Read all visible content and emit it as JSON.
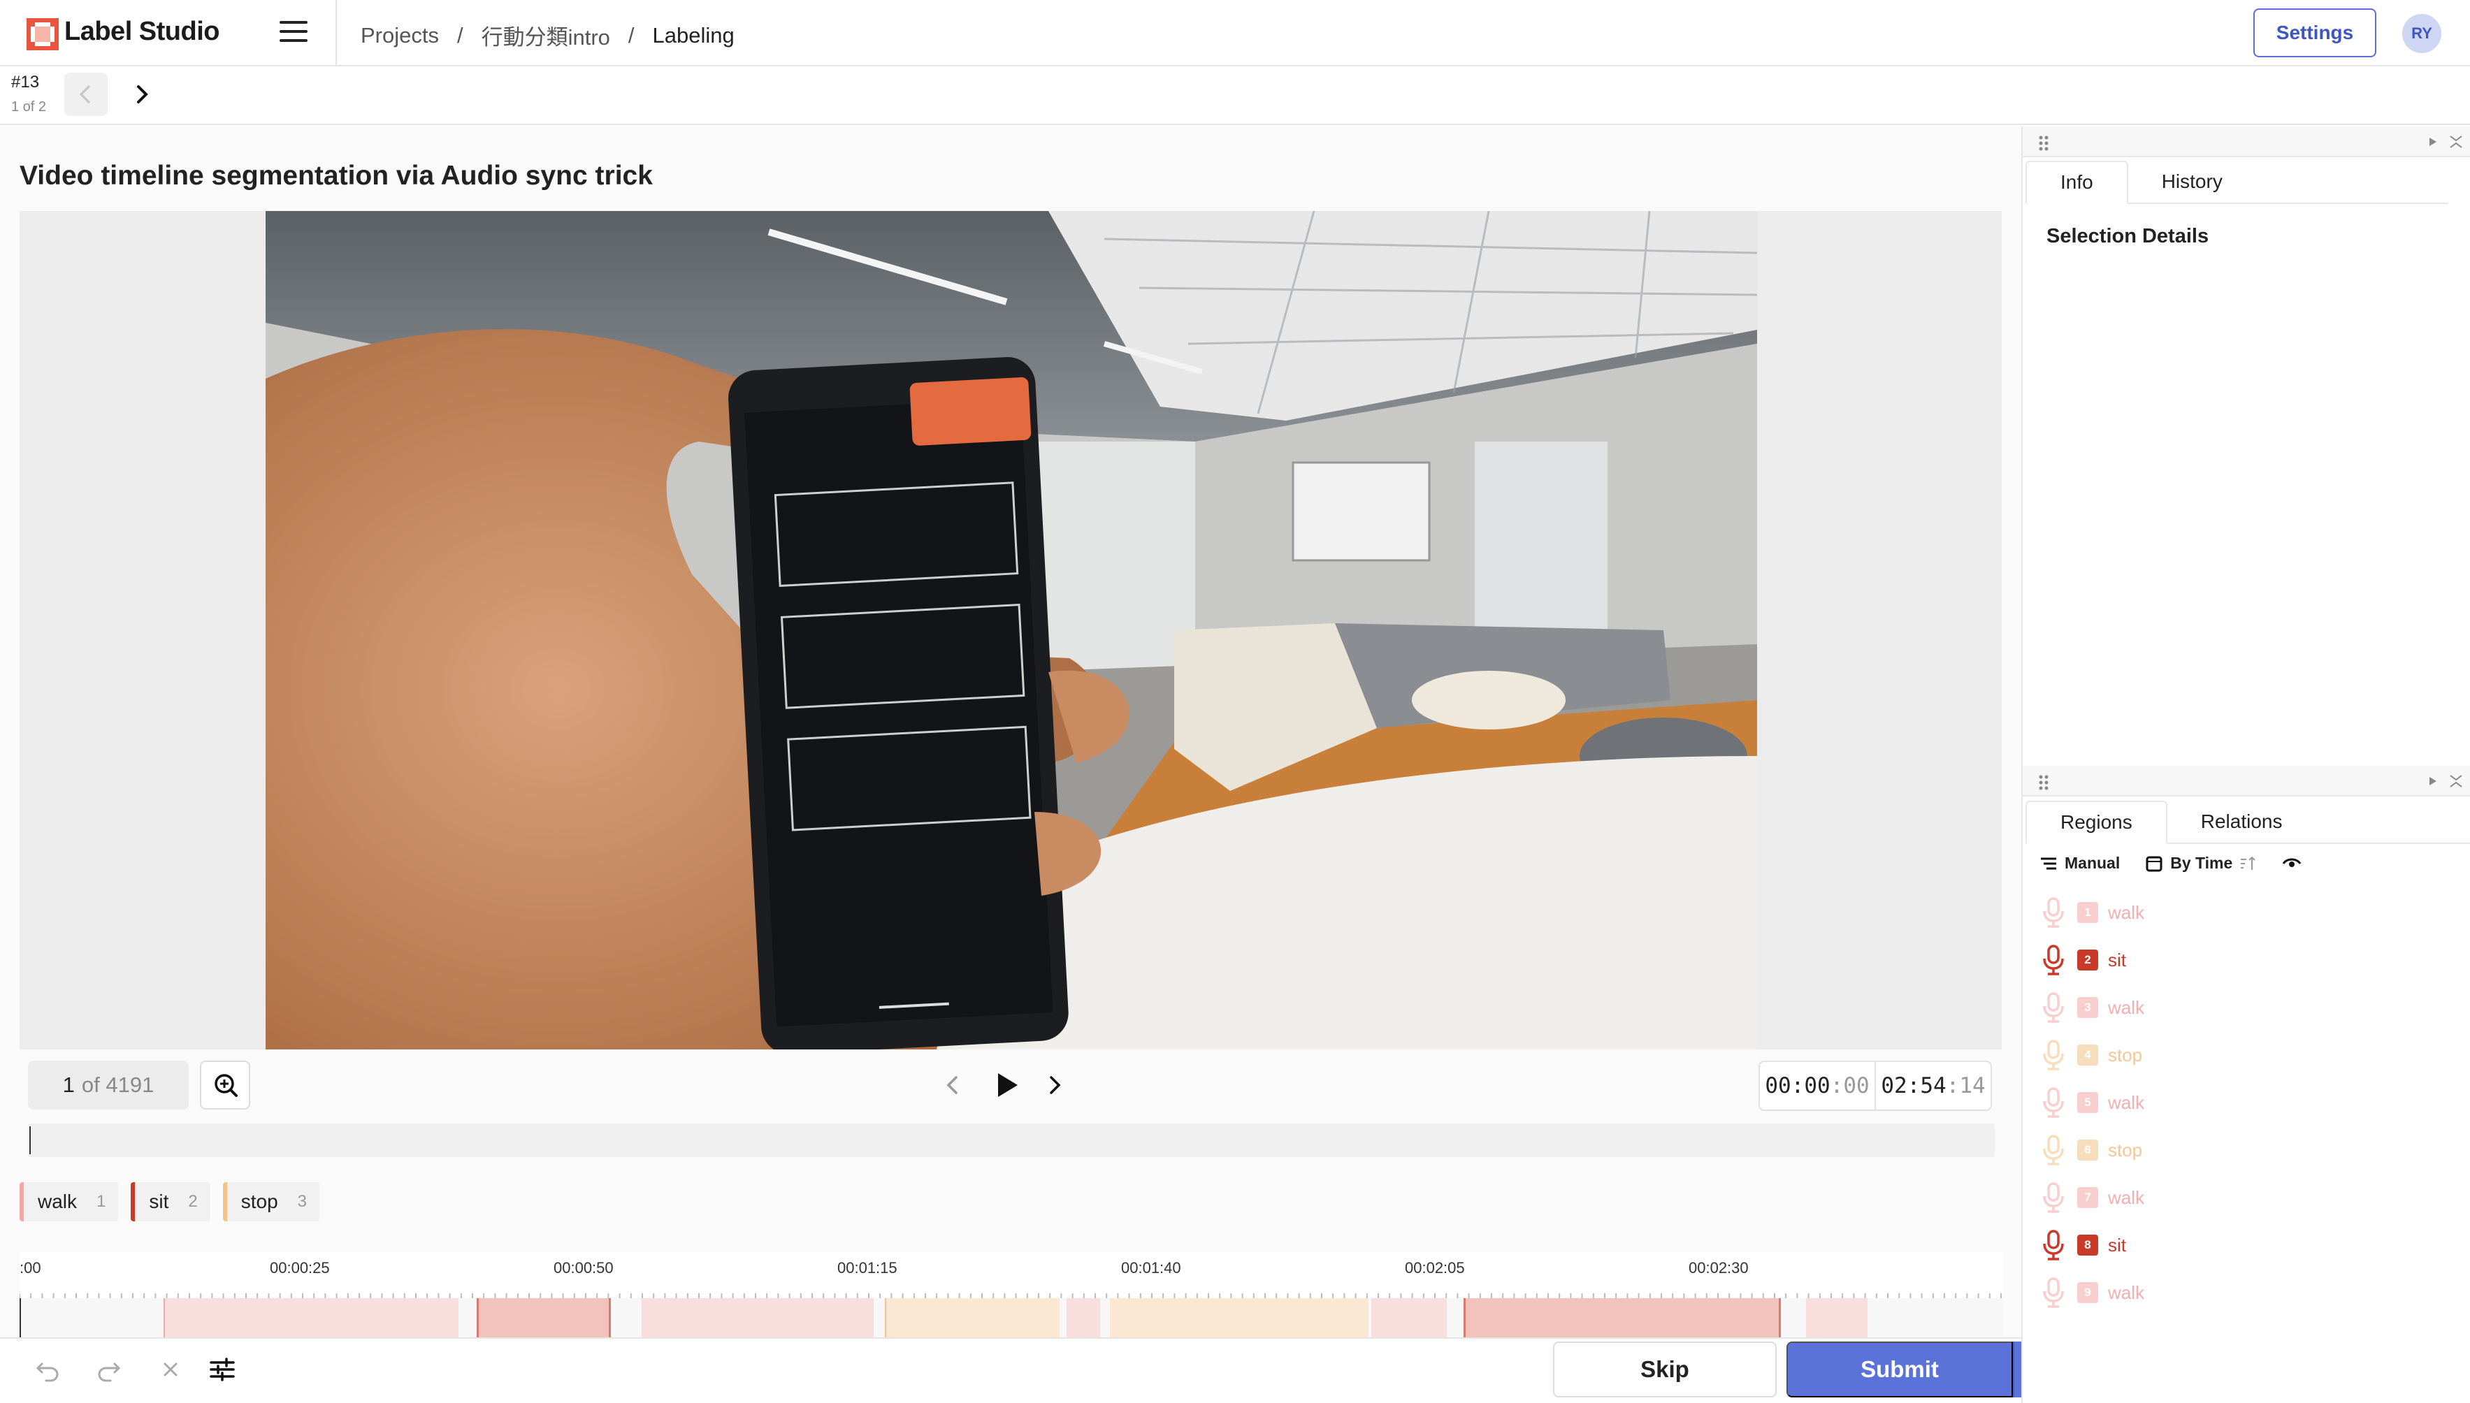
{
  "app": {
    "name": "Label Studio"
  },
  "breadcrumb": [
    "Projects",
    "/",
    "行動分類intro",
    "/",
    "Labeling"
  ],
  "header": {
    "settings_label": "Settings",
    "avatar_initials": "RY"
  },
  "task": {
    "id": "#13",
    "position": "1 of 2"
  },
  "main": {
    "title": "Video timeline segmentation via Audio sync trick"
  },
  "player": {
    "frame_current": "1",
    "frame_of": "of 4191",
    "time_current": "00:00",
    "time_current_frames": ":00",
    "time_total": "02:54",
    "time_total_frames": ":14"
  },
  "labels": [
    {
      "name": "walk",
      "hotkey": "1",
      "color": "#f4a7a7"
    },
    {
      "name": "sit",
      "hotkey": "2",
      "color": "#c93a2b"
    },
    {
      "name": "stop",
      "hotkey": "3",
      "color": "#f4c388"
    }
  ],
  "timeline": {
    "ticks": [
      ":00",
      "00:00:25",
      "00:00:50",
      "00:01:15",
      "00:01:40",
      "00:02:05",
      "00:02:30"
    ]
  },
  "right_panel": {
    "info_tabs": [
      "Info",
      "History"
    ],
    "selection_details": "Selection Details",
    "region_tabs": [
      "Regions",
      "Relations"
    ],
    "toolbar": {
      "manual": "Manual",
      "by_time": "By Time"
    },
    "regions": [
      {
        "num": "1",
        "label": "walk",
        "color": "#f4a7a7",
        "dim": true
      },
      {
        "num": "2",
        "label": "sit",
        "color": "#c93a2b",
        "dim": false
      },
      {
        "num": "3",
        "label": "walk",
        "color": "#f4a7a7",
        "dim": true
      },
      {
        "num": "4",
        "label": "stop",
        "color": "#f4c388",
        "dim": true
      },
      {
        "num": "5",
        "label": "walk",
        "color": "#f4a7a7",
        "dim": true
      },
      {
        "num": "6",
        "label": "stop",
        "color": "#f4c388",
        "dim": true
      },
      {
        "num": "7",
        "label": "walk",
        "color": "#f4a7a7",
        "dim": true
      },
      {
        "num": "8",
        "label": "sit",
        "color": "#c93a2b",
        "dim": false
      },
      {
        "num": "9",
        "label": "walk",
        "color": "#f4a7a7",
        "dim": true
      }
    ]
  },
  "footer": {
    "skip_label": "Skip",
    "submit_label": "Submit"
  }
}
